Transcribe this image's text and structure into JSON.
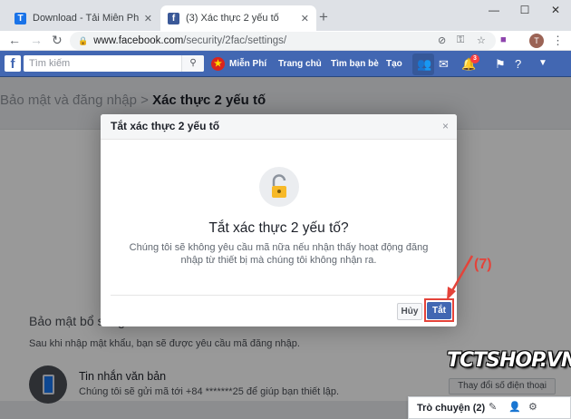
{
  "browser": {
    "tabs": [
      {
        "title": "Download - Tải Miễn Phí VN - Ph",
        "favicon": "T",
        "favicon_color": "#1a73e8",
        "active": false
      },
      {
        "title": "(3) Xác thực 2 yếu tố",
        "favicon": "f",
        "favicon_color": "#3b5998",
        "active": true
      }
    ],
    "url_host": "www.facebook.com",
    "url_path": "/security/2fac/settings/",
    "profile_initial": "T"
  },
  "fb_header": {
    "search_placeholder": "Tìm kiếm",
    "profile_name": "Miễn Phí",
    "nav_home": "Trang chủ",
    "nav_find_friends": "Tìm bạn bè",
    "nav_create": "Tạo",
    "notifications_count": "3"
  },
  "breadcrumb": {
    "parent": "Bảo mật và đăng nhập",
    "separator": ">",
    "current": "Xác thực 2 yếu tố"
  },
  "page": {
    "section_title": "Bảo mật bổ sung",
    "section_desc": "Sau khi nhập mật khẩu, bạn sẽ được yêu cầu mã đăng nhập.",
    "sms_title": "Tin nhắn văn bản",
    "sms_desc": "Chúng tôi sẽ gửi mã tới +84 *******25 để giúp bạn thiết lập.",
    "change_phone_label": "Thay đổi số điện thoại"
  },
  "chat": {
    "label": "Trò chuyện (2)"
  },
  "dialog": {
    "header": "Tắt xác thực 2 yếu tố",
    "close": "×",
    "title": "Tắt xác thực 2 yếu tố?",
    "body": "Chúng tôi sẽ không yêu cầu mã nữa nếu nhận thấy hoạt động đăng nhập từ thiết bị mà chúng tôi không nhận ra.",
    "cancel_label": "Hủy",
    "confirm_label": "Tắt"
  },
  "annotation": {
    "step_label": "(7)",
    "color": "#e4433a"
  },
  "watermark": "TCTSHOP.VN",
  "colors": {
    "fb_blue": "#4267b2",
    "overlay": "rgba(0,0,0,0.4)"
  }
}
